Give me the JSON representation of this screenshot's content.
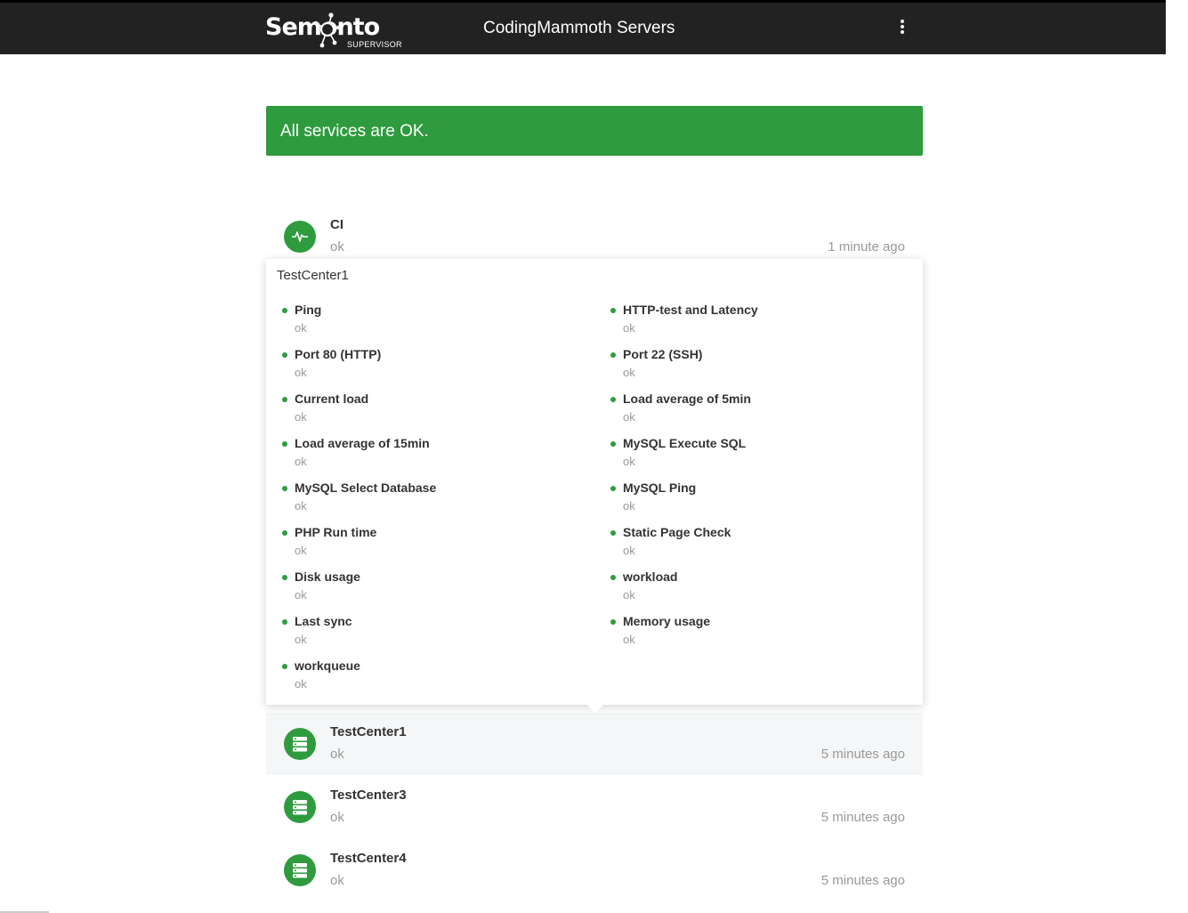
{
  "header": {
    "logo_main": "Semonto",
    "logo_sub": "SUPERVISOR",
    "title": "CodingMammoth Servers"
  },
  "alert": {
    "text": "All services are OK."
  },
  "services": [
    {
      "name": "CI",
      "status": "ok",
      "time": "1 minute ago",
      "icon": "pulse-icon"
    },
    {
      "name": "TestCenter1",
      "status": "ok",
      "time": "5 minutes ago",
      "icon": "server-icon"
    },
    {
      "name": "TestCenter3",
      "status": "ok",
      "time": "5 minutes ago",
      "icon": "server-icon"
    },
    {
      "name": "TestCenter4",
      "status": "ok",
      "time": "5 minutes ago",
      "icon": "server-icon"
    }
  ],
  "popup": {
    "title": "TestCenter1",
    "checks": [
      {
        "name": "Ping",
        "status": "ok"
      },
      {
        "name": "HTTP-test and Latency",
        "status": "ok"
      },
      {
        "name": "Port 80 (HTTP)",
        "status": "ok"
      },
      {
        "name": "Port 22 (SSH)",
        "status": "ok"
      },
      {
        "name": "Current load",
        "status": "ok"
      },
      {
        "name": "Load average of 5min",
        "status": "ok"
      },
      {
        "name": "Load average of 15min",
        "status": "ok"
      },
      {
        "name": "MySQL Execute SQL",
        "status": "ok"
      },
      {
        "name": "MySQL Select Database",
        "status": "ok"
      },
      {
        "name": "MySQL Ping",
        "status": "ok"
      },
      {
        "name": "PHP Run time",
        "status": "ok"
      },
      {
        "name": "Static Page Check",
        "status": "ok"
      },
      {
        "name": "Disk usage",
        "status": "ok"
      },
      {
        "name": "workload",
        "status": "ok"
      },
      {
        "name": "Last sync",
        "status": "ok"
      },
      {
        "name": "Memory usage",
        "status": "ok"
      },
      {
        "name": "workqueue",
        "status": "ok"
      }
    ]
  },
  "colors": {
    "ok_green": "#2e9b3e",
    "header_bg": "#222222"
  }
}
